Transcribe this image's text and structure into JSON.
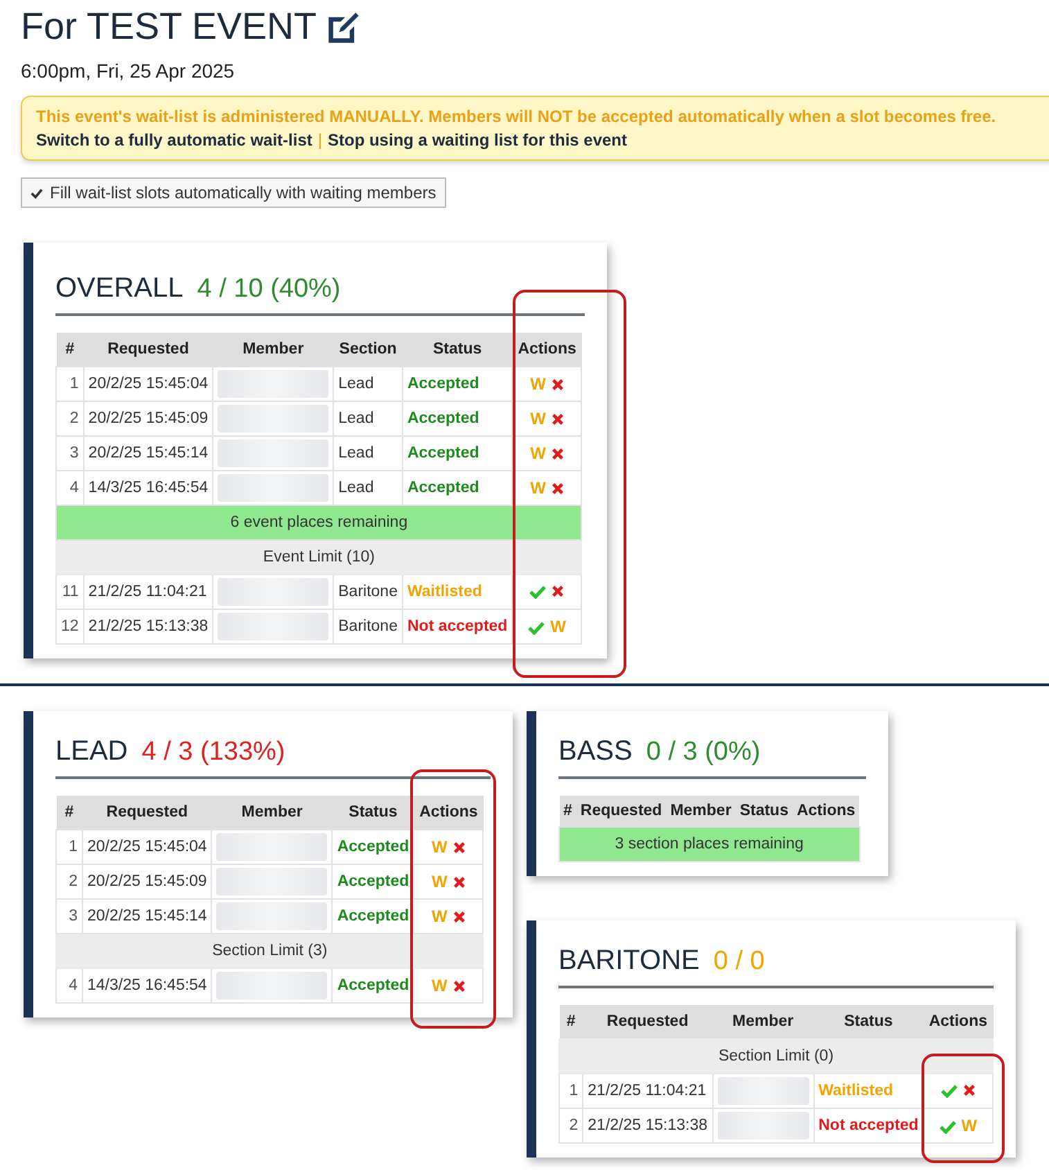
{
  "title": "For TEST EVENT",
  "datetime": "6:00pm, Fri, 25 Apr 2025",
  "alert": {
    "message": "This event's wait-list is administered MANUALLY. Members will NOT be accepted automatically when a slot becomes free.",
    "links": [
      "Switch to a fully automatic wait-list",
      "Stop using a waiting list for this event"
    ],
    "separator": "|"
  },
  "fill_button": {
    "label": "Fill wait-list slots automatically with waiting members"
  },
  "panels": [
    {
      "title": "OVERALL",
      "count": "4 / 10 (40%)",
      "color": "#2e8b2e",
      "highlight": true,
      "columns": [
        "#",
        "Requested",
        "Member",
        "Section",
        "Status",
        "Actions"
      ],
      "rows": [
        {
          "kind": "entry",
          "num": "1",
          "requested": "20/2/25 15:45:04",
          "section": "Lead",
          "status": "Accepted",
          "color": "#1e8a1e",
          "actions": [
            {
              "kind": "wait",
              "label": "W"
            },
            {
              "kind": "reject"
            }
          ]
        },
        {
          "kind": "entry",
          "num": "2",
          "requested": "20/2/25 15:45:09",
          "section": "Lead",
          "status": "Accepted",
          "color": "#1e8a1e",
          "actions": [
            {
              "kind": "wait",
              "label": "W"
            },
            {
              "kind": "reject"
            }
          ]
        },
        {
          "kind": "entry",
          "num": "3",
          "requested": "20/2/25 15:45:14",
          "section": "Lead",
          "status": "Accepted",
          "color": "#1e8a1e",
          "actions": [
            {
              "kind": "wait",
              "label": "W"
            },
            {
              "kind": "reject"
            }
          ]
        },
        {
          "kind": "entry",
          "num": "4",
          "requested": "14/3/25 16:45:54",
          "section": "Lead",
          "status": "Accepted",
          "color": "#1e8a1e",
          "actions": [
            {
              "kind": "wait",
              "label": "W"
            },
            {
              "kind": "reject"
            }
          ]
        },
        {
          "kind": "remaining",
          "text": "6 event places remaining"
        },
        {
          "kind": "limit",
          "text": "Event Limit (10)"
        },
        {
          "kind": "entry",
          "num": "11",
          "requested": "21/2/25 11:04:21",
          "section": "Baritone",
          "status": "Waitlisted",
          "color": "#f0a500",
          "actions": [
            {
              "kind": "accept"
            },
            {
              "kind": "reject"
            }
          ]
        },
        {
          "kind": "entry",
          "num": "12",
          "requested": "21/2/25 15:13:38",
          "section": "Baritone",
          "status": "Not accepted",
          "color": "#e01b1b",
          "actions": [
            {
              "kind": "accept"
            },
            {
              "kind": "wait",
              "label": "W"
            }
          ]
        }
      ]
    },
    {
      "title": "LEAD",
      "count": "4 / 3 (133%)",
      "color": "#e02020",
      "highlight": true,
      "columns": [
        "#",
        "Requested",
        "Member",
        "Status",
        "Actions"
      ],
      "rows": [
        {
          "kind": "entry",
          "num": "1",
          "requested": "20/2/25 15:45:04",
          "status": "Accepted",
          "color": "#1e8a1e",
          "actions": [
            {
              "kind": "wait",
              "label": "W"
            },
            {
              "kind": "reject"
            }
          ]
        },
        {
          "kind": "entry",
          "num": "2",
          "requested": "20/2/25 15:45:09",
          "status": "Accepted",
          "color": "#1e8a1e",
          "actions": [
            {
              "kind": "wait",
              "label": "W"
            },
            {
              "kind": "reject"
            }
          ]
        },
        {
          "kind": "entry",
          "num": "3",
          "requested": "20/2/25 15:45:14",
          "status": "Accepted",
          "color": "#1e8a1e",
          "actions": [
            {
              "kind": "wait",
              "label": "W"
            },
            {
              "kind": "reject"
            }
          ]
        },
        {
          "kind": "limit",
          "text": "Section Limit (3)"
        },
        {
          "kind": "entry",
          "num": "4",
          "requested": "14/3/25 16:45:54",
          "status": "Accepted",
          "color": "#1e8a1e",
          "actions": [
            {
              "kind": "wait",
              "label": "W"
            },
            {
              "kind": "reject"
            }
          ]
        }
      ]
    },
    {
      "title": "BASS",
      "count": "0 / 3 (0%)",
      "color": "#2e8b2e",
      "highlight": false,
      "columns": [
        "#",
        "Requested",
        "Member",
        "Status",
        "Actions"
      ],
      "rows": [
        {
          "kind": "remaining",
          "text": "3 section places remaining"
        }
      ]
    },
    {
      "title": "BARITONE",
      "count": "0 / 0",
      "color": "#f0a500",
      "highlight": true,
      "columns": [
        "#",
        "Requested",
        "Member",
        "Status",
        "Actions"
      ],
      "rows": [
        {
          "kind": "limit",
          "text": "Section Limit (0)"
        },
        {
          "kind": "entry",
          "num": "1",
          "requested": "21/2/25 11:04:21",
          "status": "Waitlisted",
          "color": "#f0a500",
          "actions": [
            {
              "kind": "accept"
            },
            {
              "kind": "reject"
            }
          ]
        },
        {
          "kind": "entry",
          "num": "2",
          "requested": "21/2/25 15:13:38",
          "status": "Not accepted",
          "color": "#e01b1b",
          "actions": [
            {
              "kind": "accept"
            },
            {
              "kind": "wait",
              "label": "W"
            }
          ]
        }
      ]
    }
  ]
}
